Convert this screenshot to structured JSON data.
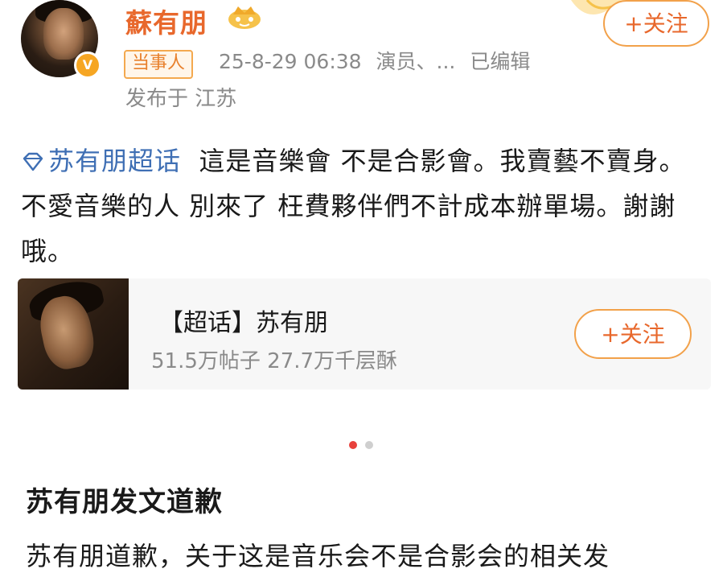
{
  "header": {
    "user_name": "蘇有朋",
    "follow_label": "+关注",
    "tag_label": "当事人",
    "timestamp": "25-8-29 06:38",
    "role": "演员、...",
    "edited": "已编辑",
    "location": "发布于 江苏"
  },
  "post": {
    "topic_link": "苏有朋超话",
    "text": "這是音樂會 不是合影會。我賣藝不賣身。不愛音樂的人 別來了 枉費夥伴們不計成本辦單場。謝謝哦。"
  },
  "topic_card": {
    "title": "【超话】苏有朋",
    "stats": "51.5万帖子 27.7万千层酥",
    "follow_label": "+关注"
  },
  "carousel": {
    "dots": 2,
    "active": 0
  },
  "article": {
    "title": "苏有朋发文道歉",
    "body": "苏有朋道歉，关于这是音乐会不是合影会的相关发"
  },
  "icons": {
    "verified": "verified-v-icon",
    "crown": "crown-badge-icon",
    "topic": "diamond-topic-icon"
  },
  "colors": {
    "accent_orange": "#e8682c",
    "link_blue": "#3f6fb4",
    "dot_active": "#e8413c"
  }
}
